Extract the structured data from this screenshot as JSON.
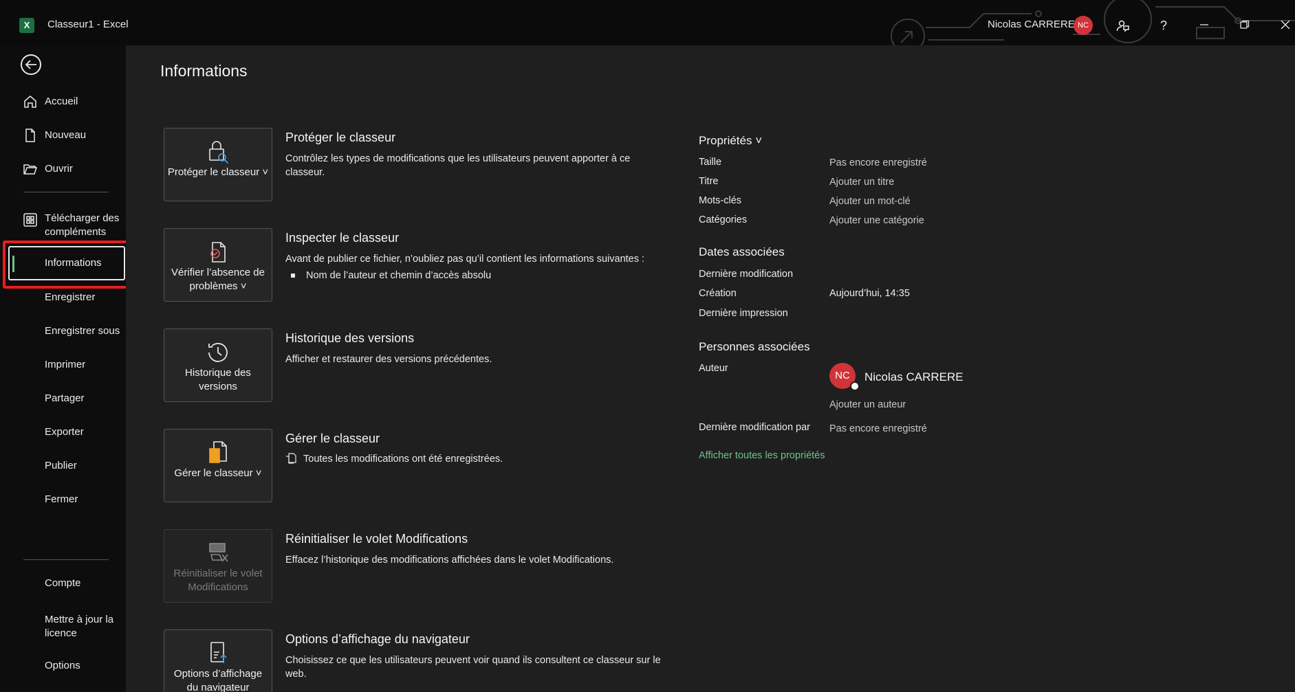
{
  "titlebar": {
    "app_title": "Classeur1  -  Excel",
    "user_name": "Nicolas CARRERE",
    "user_initials": "NC",
    "help_label": "?",
    "logo_letter": "X"
  },
  "sidebar": {
    "items": [
      {
        "label": "Accueil",
        "icon": "home-icon"
      },
      {
        "label": "Nouveau",
        "icon": "new-document-icon"
      },
      {
        "label": "Ouvrir",
        "icon": "open-folder-icon"
      },
      {
        "label": "Télécharger des compléments",
        "icon": "add-ins-icon"
      },
      {
        "label": "Informations",
        "icon": null,
        "active": true
      },
      {
        "label": "Enregistrer"
      },
      {
        "label": "Enregistrer sous"
      },
      {
        "label": "Imprimer"
      },
      {
        "label": "Partager"
      },
      {
        "label": "Exporter"
      },
      {
        "label": "Publier"
      },
      {
        "label": "Fermer"
      },
      {
        "label": "Compte"
      },
      {
        "label": "Mettre à jour la licence"
      },
      {
        "label": "Options"
      }
    ]
  },
  "main": {
    "title": "Informations",
    "sections": [
      {
        "button": "Protéger le classeur ˅",
        "title": "Protéger le classeur",
        "desc": "Contrôlez les types de modifications que les utilisateurs peuvent apporter à ce classeur."
      },
      {
        "button": "Vérifier l’absence de problèmes ˅",
        "title": "Inspecter le classeur",
        "desc": "Avant de publier ce fichier, n’oubliez pas qu’il contient les informations suivantes :",
        "bullet": "Nom de l’auteur et chemin d’accès absolu"
      },
      {
        "button": "Historique des versions",
        "title": "Historique des versions",
        "desc": "Afficher et restaurer des versions précédentes."
      },
      {
        "button": "Gérer le classeur ˅",
        "title": "Gérer le classeur",
        "desc": "Toutes les modifications ont été enregistrées."
      },
      {
        "button": "Réinitialiser le volet Modifications",
        "title": "Réinitialiser le volet Modifications",
        "desc": "Effacez l’historique des modifications affichées dans le volet Modifications."
      },
      {
        "button": "Options d’affichage du navigateur",
        "title": "Options d’affichage du navigateur",
        "desc": "Choisissez ce que les utilisateurs peuvent voir quand ils consultent ce classeur sur le web."
      }
    ]
  },
  "properties": {
    "header": "Propriétés ˅",
    "rows": [
      {
        "key": "Taille",
        "value": "Pas encore enregistré"
      },
      {
        "key": "Titre",
        "value": "Ajouter un titre"
      },
      {
        "key": "Mots-clés",
        "value": "Ajouter un mot-clé"
      },
      {
        "key": "Catégories",
        "value": "Ajouter une catégorie"
      }
    ],
    "dates_header": "Dates associées",
    "dates": [
      {
        "key": "Dernière modification",
        "value": ""
      },
      {
        "key": "Création",
        "value": "Aujourd’hui, 14:35"
      },
      {
        "key": "Dernière impression",
        "value": ""
      }
    ],
    "people_header": "Personnes associées",
    "author_label": "Auteur",
    "author_initials": "NC",
    "author_name": "Nicolas CARRERE",
    "add_author": "Ajouter un auteur",
    "last_modified_by_label": "Dernière modification par",
    "last_modified_by_value": "Pas encore enregistré",
    "show_all": "Afficher toutes les propriétés"
  }
}
